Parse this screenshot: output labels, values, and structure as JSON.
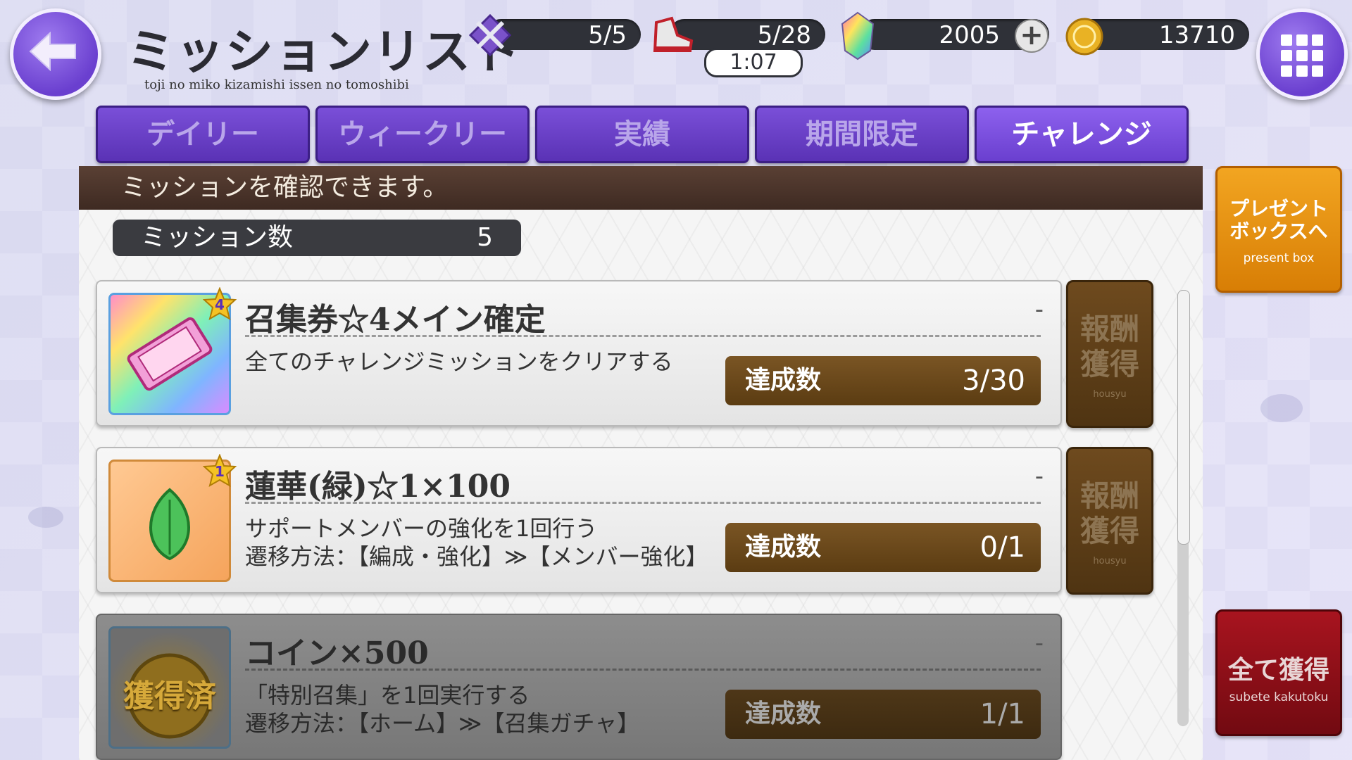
{
  "header": {
    "title": "ミッションリスト",
    "subtitle": "toji no miko kizamishi issen no tomoshibi"
  },
  "stats": {
    "battle": "5/5",
    "stamina": "5/28",
    "stamina_timer": "1:07",
    "gems": "2005",
    "coins": "13710"
  },
  "tabs": [
    {
      "label": "デイリー",
      "active": false
    },
    {
      "label": "ウィークリー",
      "active": false
    },
    {
      "label": "実績",
      "active": false
    },
    {
      "label": "期間限定",
      "active": false
    },
    {
      "label": "チャレンジ",
      "active": true
    }
  ],
  "banner": "ミッションを確認できます。",
  "mission_count": {
    "label": "ミッション数",
    "value": "5"
  },
  "missions": [
    {
      "reward": "召集券☆4メイン確定",
      "star": "4",
      "icon": "ticket-icon",
      "desc1": "全てのチャレンジミッションをクリアする",
      "desc2": "",
      "progress_label": "達成数",
      "progress": "3/30",
      "claim": "報酬獲得",
      "claim_sub": "housyu",
      "status": "-"
    },
    {
      "reward": "蓮華(緑)☆1×100",
      "star": "1",
      "icon": "lotus-icon",
      "desc1": "サポートメンバーの強化を1回行う",
      "desc2": "遷移方法：【編成・強化】≫【メンバー強化】",
      "progress_label": "達成数",
      "progress": "0/1",
      "claim": "報酬獲得",
      "claim_sub": "housyu",
      "status": "-"
    },
    {
      "reward": "コイン×500",
      "icon": "coin-icon",
      "icon_text": "獲得済",
      "desc1": "「特別召集」を1回実行する",
      "desc2": "遷移方法：【ホーム】≫【召集ガチャ】",
      "progress_label": "達成数",
      "progress": "1/1",
      "status": "-"
    }
  ],
  "side": {
    "present_label": "プレゼントボックスへ",
    "present_sub": "present box",
    "all_label": "全て獲得",
    "all_sub": "subete kakutoku"
  },
  "colors": {
    "accent": "#6a3fcf",
    "present": "#e28f0e",
    "collect_all": "#8f0f18",
    "progress": "#6a4a1c"
  }
}
